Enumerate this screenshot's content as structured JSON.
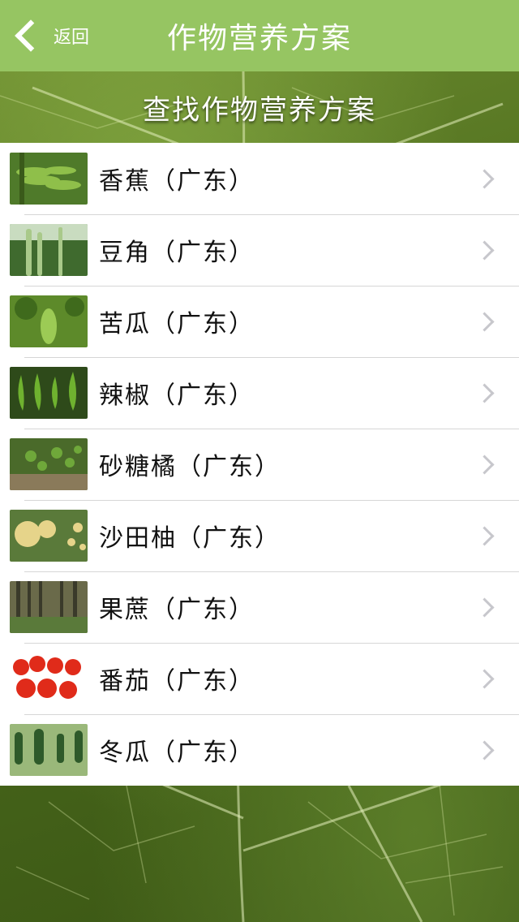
{
  "nav": {
    "back_label": "返回",
    "title": "作物营养方案",
    "bg_color": "#96c562"
  },
  "section": {
    "title": "查找作物营养方案"
  },
  "crops": [
    {
      "label": "香蕉（广东）",
      "icon": "banana-photo"
    },
    {
      "label": "豆角（广东）",
      "icon": "cowpea-photo"
    },
    {
      "label": "苦瓜（广东）",
      "icon": "bitter-melon-photo"
    },
    {
      "label": "辣椒（广东）",
      "icon": "chili-photo"
    },
    {
      "label": "砂糖橘（广东）",
      "icon": "mandarin-photo"
    },
    {
      "label": "沙田柚（广东）",
      "icon": "pomelo-photo"
    },
    {
      "label": "果蔗（广东）",
      "icon": "sugarcane-photo"
    },
    {
      "label": "番茄（广东）",
      "icon": "tomato-photo"
    },
    {
      "label": "冬瓜（广东）",
      "icon": "wax-gourd-photo"
    }
  ]
}
